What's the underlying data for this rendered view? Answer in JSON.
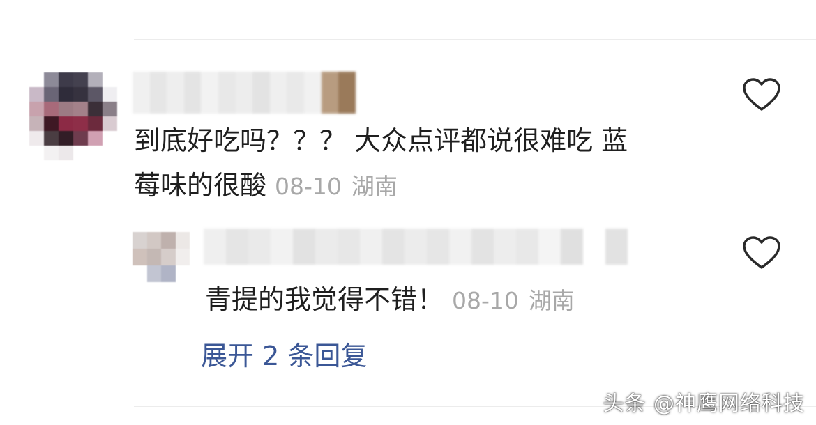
{
  "comment": {
    "text_line1": "到底好吃吗？？？ 大众点评都说很难吃 蓝",
    "text_line2": "莓味的很酸",
    "date": "08-10",
    "location": "湖南",
    "like_icon": "heart-outline-icon"
  },
  "reply": {
    "text": "青提的我觉得不错！",
    "date": "08-10",
    "location": "湖南",
    "like_icon": "heart-outline-icon"
  },
  "expand_replies_label": "展开 2 条回复",
  "watermark": "头条 @神鹰网络科技",
  "colors": {
    "text": "#1f1f1f",
    "meta": "#a8a8a8",
    "link": "#3b5796",
    "divider": "#ececec"
  }
}
